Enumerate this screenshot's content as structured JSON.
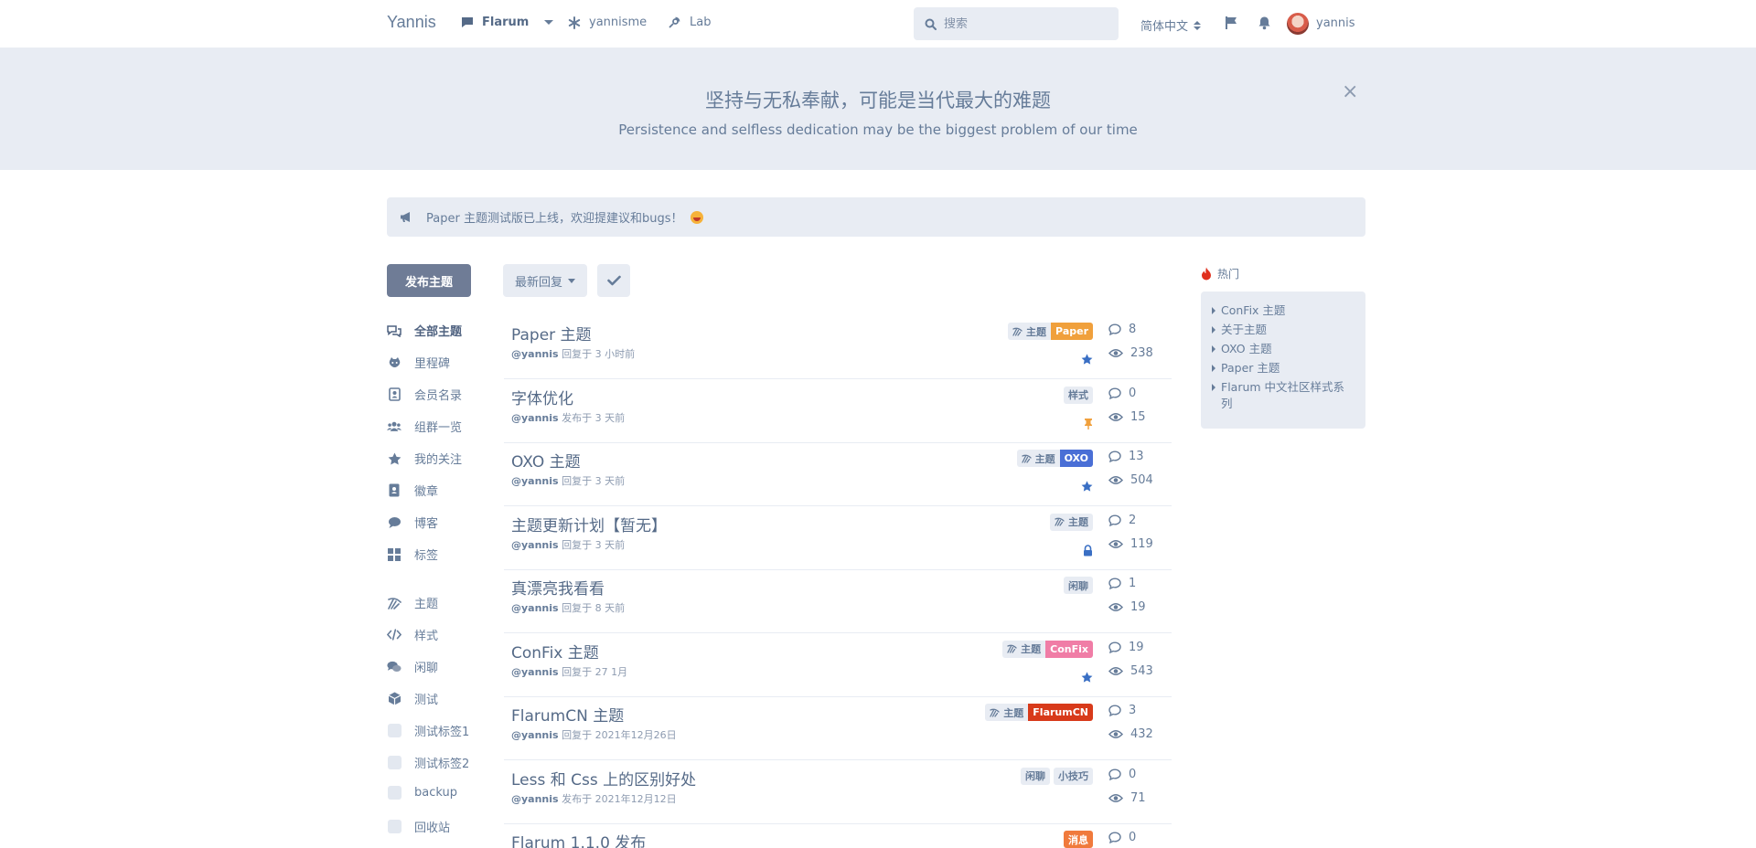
{
  "header": {
    "brand": "Yannis",
    "nav": [
      {
        "label": "Flarum",
        "icon": "comment-icon"
      },
      {
        "label": "yannisme",
        "icon": "asterisk-icon"
      },
      {
        "label": "Lab",
        "icon": "lab-icon"
      }
    ],
    "search_placeholder": "搜索",
    "language": "简体中文",
    "username": "yannis"
  },
  "hero": {
    "title": "坚持与无私奉献，可能是当代最大的难题",
    "subtitle": "Persistence and selfless dedication may be the biggest problem of our time",
    "close": "×"
  },
  "notice": {
    "text": "Paper 主题测试版已上线，欢迎提建议和bugs！"
  },
  "sidebar": {
    "start_button": "发布主题",
    "items": [
      {
        "label": "全部主题",
        "icon": "comments-icon"
      },
      {
        "label": "里程碑",
        "icon": "github-icon"
      },
      {
        "label": "会员名录",
        "icon": "address-book-icon"
      },
      {
        "label": "组群一览",
        "icon": "users-icon"
      },
      {
        "label": "我的关注",
        "icon": "star-icon"
      },
      {
        "label": "徽章",
        "icon": "id-badge-icon"
      },
      {
        "label": "博客",
        "icon": "comment-icon"
      },
      {
        "label": "标签",
        "icon": "th-large-icon"
      },
      {
        "label": "主题",
        "icon": "swatch-icon"
      },
      {
        "label": "样式",
        "icon": "code-icon"
      },
      {
        "label": "闲聊",
        "icon": "chat-icon"
      },
      {
        "label": "测试",
        "icon": "cube-icon"
      },
      {
        "label": "测试标签1",
        "icon": "tag-square-icon"
      },
      {
        "label": "测试标签2",
        "icon": "tag-square-icon"
      },
      {
        "label": "backup",
        "icon": "tag-square-icon"
      },
      {
        "label": "回收站",
        "icon": "tag-square-icon"
      }
    ]
  },
  "toolbar": {
    "sort_label": "最新回复"
  },
  "discussions": [
    {
      "title": "Paper 主题",
      "user": "@yannis",
      "action": "回复于 3 小时前",
      "tags": [
        {
          "label": "主题",
          "kind": "sub",
          "icon": true
        },
        {
          "label": "Paper",
          "kind": "prim",
          "color": "#f0a03c"
        }
      ],
      "badge": "star",
      "replies": "8",
      "views": "238"
    },
    {
      "title": "字体优化",
      "user": "@yannis",
      "action": "发布于 3 天前",
      "tags": [
        {
          "label": "样式",
          "kind": "sub",
          "icon": false
        }
      ],
      "badge": "pin",
      "replies": "0",
      "views": "15"
    },
    {
      "title": "OXO 主题",
      "user": "@yannis",
      "action": "回复于 3 天前",
      "tags": [
        {
          "label": "主题",
          "kind": "sub",
          "icon": true
        },
        {
          "label": "OXO",
          "kind": "prim",
          "color": "#4a6fd6"
        }
      ],
      "badge": "star",
      "replies": "13",
      "views": "504"
    },
    {
      "title": "主题更新计划【暂无】",
      "user": "@yannis",
      "action": "回复于 3 天前",
      "tags": [
        {
          "label": "主题",
          "kind": "sub",
          "icon": true
        }
      ],
      "badge": "lock",
      "replies": "2",
      "views": "119"
    },
    {
      "title": "真漂亮我看看",
      "user": "@yannis",
      "action": "回复于 8 天前",
      "tags": [
        {
          "label": "闲聊",
          "kind": "sub",
          "icon": false
        }
      ],
      "badge": "",
      "replies": "1",
      "views": "19"
    },
    {
      "title": "ConFix 主题",
      "user": "@yannis",
      "action": "回复于 27 1月",
      "tags": [
        {
          "label": "主题",
          "kind": "sub",
          "icon": true
        },
        {
          "label": "ConFix",
          "kind": "prim",
          "color": "#f07da6"
        }
      ],
      "badge": "star",
      "replies": "19",
      "views": "543"
    },
    {
      "title": "FlarumCN 主题",
      "user": "@yannis",
      "action": "回复于 2021年12月26日",
      "tags": [
        {
          "label": "主题",
          "kind": "sub",
          "icon": true
        },
        {
          "label": "FlarumCN",
          "kind": "prim",
          "color": "#d83a1a"
        }
      ],
      "badge": "",
      "replies": "3",
      "views": "432"
    },
    {
      "title": "Less 和 Css 上的区别好处",
      "user": "@yannis",
      "action": "发布于 2021年12月12日",
      "tags": [
        {
          "label": "闲聊",
          "kind": "sub",
          "icon": false
        },
        {
          "label": "小技巧",
          "kind": "sub",
          "icon": false
        }
      ],
      "badge": "",
      "replies": "0",
      "views": "71"
    },
    {
      "title": "Flarum 1.1.0 发布",
      "user": "",
      "action": "",
      "tags": [
        {
          "label": "消息",
          "kind": "prim",
          "color": "#f07a3c"
        }
      ],
      "badge": "",
      "replies": "0",
      "views": ""
    }
  ],
  "hot": {
    "heading": "热门",
    "items": [
      "ConFix 主题",
      "关于主题",
      "OXO 主题",
      "Paper 主题",
      "Flarum 中文社区样式系列"
    ]
  },
  "colors": {
    "page_bg": "#ffffff",
    "panel_bg": "#e8ecf3",
    "text": "#667c99",
    "primary_button": "#6f7c96",
    "star": "#3a6fc4",
    "pin": "#f0a03c",
    "hot_fire": "#e0301e"
  }
}
